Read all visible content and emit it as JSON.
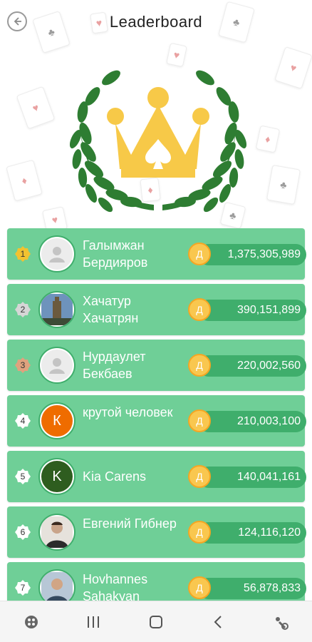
{
  "header": {
    "title": "Leaderboard",
    "back_icon": "back-arrow-icon"
  },
  "colors": {
    "row": "#6fcf97",
    "pill": "#3fae6c",
    "crown": "#f7c948",
    "laurel": "#2e7d32",
    "coin": "#f9c74f"
  },
  "players": [
    {
      "rank": "1",
      "name": "Галымжан Бердияров",
      "score": "1,375,305,989",
      "coin_label": "Д",
      "avatar": {
        "kind": "placeholder"
      }
    },
    {
      "rank": "2",
      "name": "Хачатур Хачатрян",
      "score": "390,151,899",
      "coin_label": "Д",
      "avatar": {
        "kind": "photo"
      }
    },
    {
      "rank": "3",
      "name": "Нурдаулет Бекбаев",
      "score": "220,002,560",
      "coin_label": "Д",
      "avatar": {
        "kind": "placeholder"
      }
    },
    {
      "rank": "4",
      "name": "крутой человек",
      "score": "210,003,100",
      "coin_label": "Д",
      "avatar": {
        "kind": "letter",
        "letter": "К",
        "color": "#ef6c00"
      }
    },
    {
      "rank": "5",
      "name": "Kia Carens",
      "score": "140,041,161",
      "coin_label": "Д",
      "avatar": {
        "kind": "letter",
        "letter": "K",
        "color": "#2e5d1f"
      }
    },
    {
      "rank": "6",
      "name": "Евгений Гибнер",
      "score": "124,116,120",
      "coin_label": "Д",
      "avatar": {
        "kind": "photo"
      }
    },
    {
      "rank": "7",
      "name": "Hovhannes Sahakyan",
      "score": "56,878,833",
      "coin_label": "Д",
      "avatar": {
        "kind": "photo"
      }
    }
  ],
  "navbar": [
    "apps-icon",
    "recents-icon",
    "home-icon",
    "back-icon",
    "assistant-icon"
  ]
}
